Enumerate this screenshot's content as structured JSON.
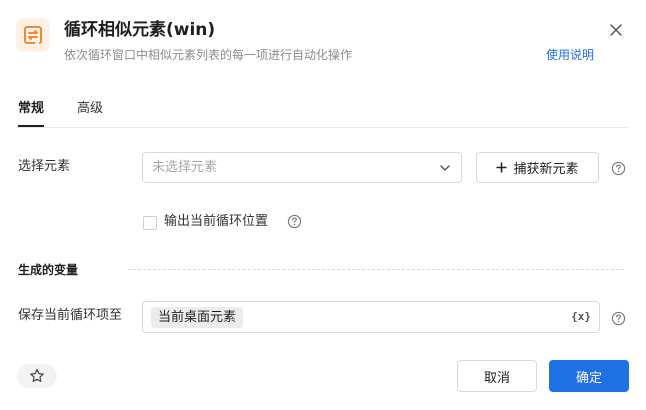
{
  "header": {
    "title": "循环相似元素(win)",
    "subtitle": "依次循环窗口中相似元素列表的每一项进行自动化操作",
    "help_link": "使用说明",
    "icon": "loop-arrows-icon",
    "icon_color": "#f07c1c"
  },
  "tabs": [
    {
      "label": "常规",
      "active": true
    },
    {
      "label": "高级",
      "active": false
    }
  ],
  "form": {
    "select_element": {
      "label": "选择元素",
      "placeholder": "未选择元素",
      "capture_button": "捕获新元素"
    },
    "output_position": {
      "label": "输出当前循环位置",
      "checked": false
    }
  },
  "variables": {
    "section_title": "生成的变量",
    "save_item": {
      "label": "保存当前循环项至",
      "value": "当前桌面元素",
      "var_icon": "{x}"
    }
  },
  "footer": {
    "cancel_label": "取消",
    "ok_label": "确定"
  },
  "colors": {
    "primary": "#1f6fe5",
    "accent": "#f07c1c"
  }
}
